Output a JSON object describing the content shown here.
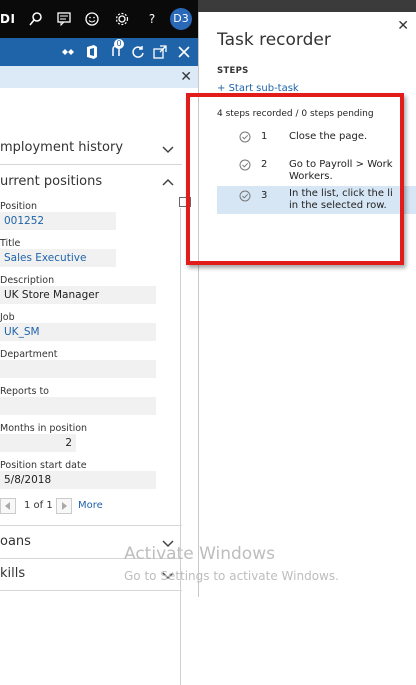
{
  "topbar": {
    "brand": "DI",
    "avatar": "D3",
    "icons": [
      "search-icon",
      "chat-icon",
      "smiley-icon",
      "gear-icon",
      "help-icon"
    ]
  },
  "actionbar": {
    "icons": [
      "diamond-icon",
      "office-icon",
      "attach-icon",
      "refresh-icon",
      "popout-icon",
      "close-icon"
    ],
    "attach_badge": "0"
  },
  "leftpage": {
    "sections": [
      {
        "title": "mployment history",
        "expanded": false
      },
      {
        "title": "urrent positions",
        "expanded": true
      }
    ],
    "fields": [
      {
        "label": "Position",
        "value": "001252",
        "link": true
      },
      {
        "label": "Title",
        "value": "Sales Executive",
        "link": true
      },
      {
        "label": "Description",
        "value": "UK Store Manager",
        "link": false
      },
      {
        "label": "Job",
        "value": "UK_SM",
        "link": true
      },
      {
        "label": "Department",
        "value": "",
        "link": false
      },
      {
        "label": "Reports to",
        "value": "",
        "link": false
      },
      {
        "label": "Months in position",
        "value": "2",
        "link": false
      },
      {
        "label": "Position start date",
        "value": "5/8/2018",
        "link": false
      }
    ],
    "pager": {
      "text": "1 of 1",
      "more": "More"
    },
    "bottom_sections": [
      {
        "title": "oans"
      },
      {
        "title": "kills"
      }
    ]
  },
  "taskrecorder": {
    "title": "Task recorder",
    "steps_heading": "STEPS",
    "start_subtask": "Start sub-task",
    "status": "4 steps recorded / 0 steps pending",
    "steps": [
      {
        "num": "1",
        "line1": "Close the page.",
        "line2": "",
        "selected": false
      },
      {
        "num": "2",
        "line1": "Go to Payroll > Work",
        "line2": "Workers.",
        "selected": false
      },
      {
        "num": "3",
        "line1": "In the list, click the li",
        "line2": "in the selected row.",
        "selected": true
      }
    ]
  },
  "watermark": {
    "line1": "Activate Windows",
    "line2": "Go to Settings to activate Windows."
  },
  "colors": {
    "accent": "#1f63a9",
    "highlight": "#e21b1b",
    "selected_row": "#d7e6f5"
  }
}
